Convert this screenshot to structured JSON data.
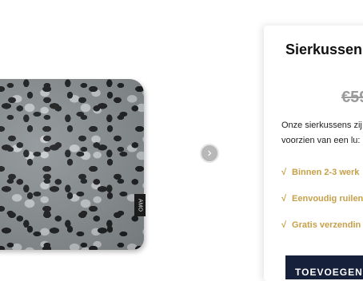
{
  "product": {
    "title": "Sierkussen",
    "old_price": "€59",
    "tag_label": "AMO",
    "description_lines": [
      "Onze sierkussens zij",
      "voorzien van een lu:"
    ]
  },
  "usps": [
    {
      "check": "√",
      "label": "Binnen 2-3 werk"
    },
    {
      "check": "√",
      "label": "Eenvoudig ruilen"
    },
    {
      "check": "√",
      "label": "Gratis verzendin"
    }
  ],
  "cart": {
    "add_label": "TOEVOEGEN"
  },
  "gallery": {
    "next_arrow": "›"
  },
  "colors": {
    "accent": "#c6a04a",
    "button": "#17203a",
    "strike_price": "#9b9b9b"
  }
}
